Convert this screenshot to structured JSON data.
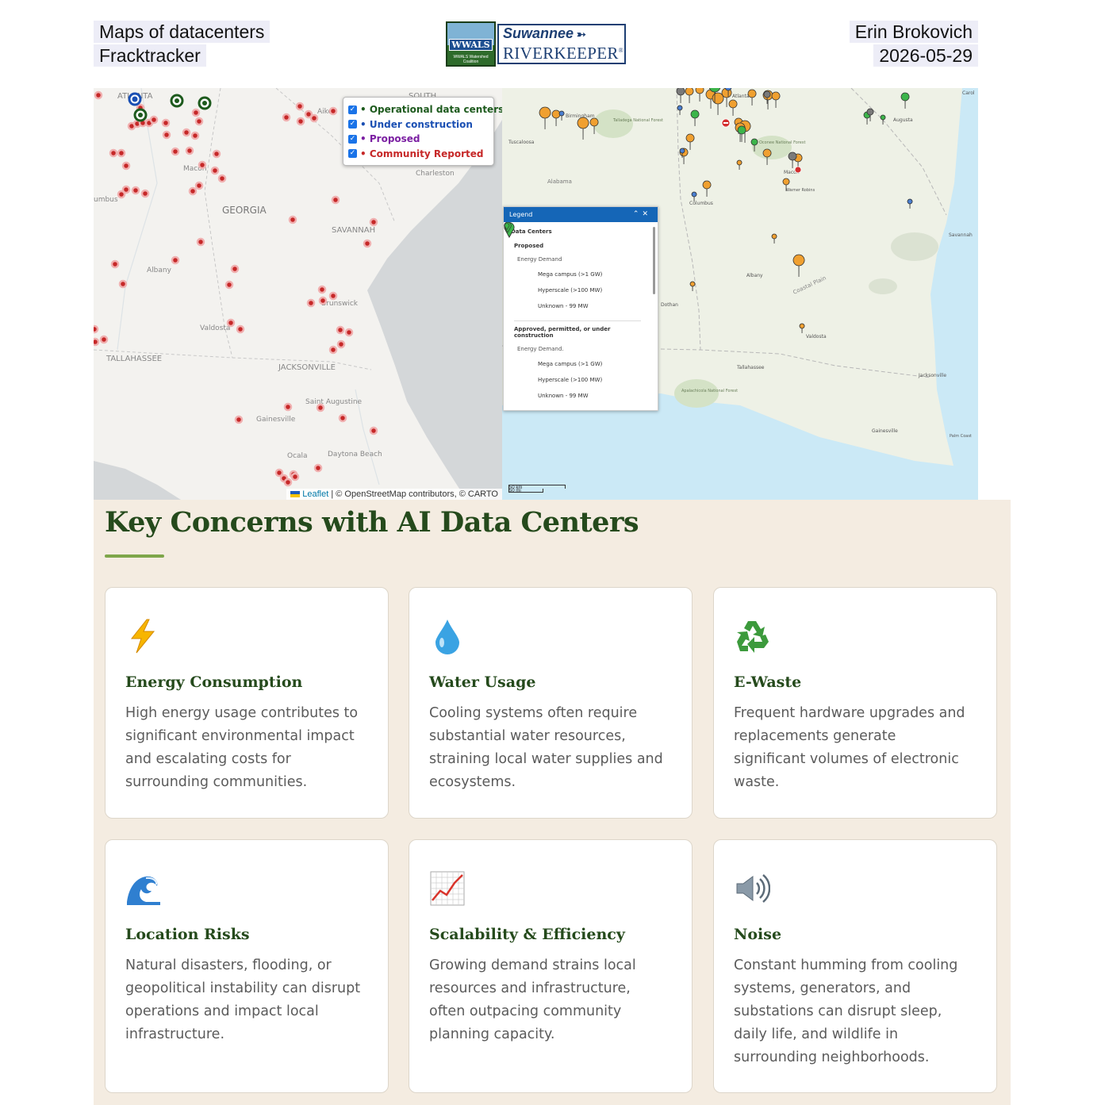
{
  "header": {
    "left_line1": "Maps of datacenters",
    "left_line2": "Fracktracker",
    "right_line1": "Erin Brokovich",
    "right_line2": "2026-05-29",
    "logo": {
      "badge_text": "WWALS",
      "badge_subtext": "WWALS Watershed Coalition",
      "name_line1": "Suwannee",
      "name_line2": "RIVERKEEPER",
      "name_line2_mark": "®"
    }
  },
  "left_map": {
    "place_labels": [
      "ATLANTA",
      "SOUTH",
      "Aiken",
      "Macon",
      "Charleston",
      "umbus",
      "GEORGIA",
      "SAVANNAH",
      "Albany",
      "Brunswick",
      "Valdosta",
      "TALLAHASSEE",
      "JACKSONVILLE",
      "Saint Augustine",
      "Gainesville",
      "Ocala",
      "Daytona Beach"
    ],
    "layers": [
      {
        "label": "Operational data centers",
        "color": "#1d5a1d",
        "checked": true
      },
      {
        "label": "Under construction",
        "color": "#1a4fb3",
        "checked": true
      },
      {
        "label": "Proposed",
        "color": "#7b1fa2",
        "checked": true
      },
      {
        "label": "Community Reported",
        "color": "#c62828",
        "checked": true
      }
    ],
    "attribution": {
      "leaflet": "Leaflet",
      "rest": " | © OpenStreetMap contributors, © CARTO"
    }
  },
  "right_map": {
    "place_labels": [
      "Birmingham",
      "Talladega National Forest",
      "Tuscaloosa",
      "Alabama",
      "Atlanta",
      "Augusta",
      "Oconee National Forest",
      "Macon",
      "Warner Robins",
      "Columbus",
      "Savannah",
      "Albany",
      "Coastal Plain",
      "Dothan",
      "Valdosta",
      "Tallahassee",
      "Apalachicola National Forest",
      "Jacksonville",
      "Gainesville",
      "Palm Coast",
      "Carol"
    ],
    "legend": {
      "header": "Legend",
      "title": "Data Centers",
      "group1": "Proposed",
      "group2": "Approved, permitted, or under construction",
      "energy_label": "Energy Demand",
      "group2_energy_label": "Energy Demand.",
      "items": [
        "Mega campus (>1 GW)",
        "Hyperscale (>100 MW)",
        "Unknown - 99 MW"
      ],
      "proposed_color": "#f0a030",
      "approved_color": "#3cb54a"
    },
    "scale": {
      "km": "50 km",
      "mi": "50 mi"
    }
  },
  "concerns": {
    "title": "Key Concerns with AI Data Centers",
    "cards": [
      {
        "icon": "lightning-icon",
        "title": "Energy Consumption",
        "text": "High energy usage contributes to significant environmental impact and escalating costs for surrounding communities."
      },
      {
        "icon": "water-drop-icon",
        "title": "Water Usage",
        "text": "Cooling systems often require substantial water resources, straining local water supplies and ecosystems."
      },
      {
        "icon": "recycle-icon",
        "title": "E-Waste",
        "text": "Frequent hardware upgrades and replacements generate significant volumes of electronic waste."
      },
      {
        "icon": "wave-icon",
        "title": "Location Risks",
        "text": "Natural disasters, flooding, or geopolitical instability can disrupt operations and impact local infrastructure."
      },
      {
        "icon": "chart-increasing-icon",
        "title": "Scalability & Efficiency",
        "text": "Growing demand strains local resources and infrastructure, often outpacing community planning capacity."
      },
      {
        "icon": "speaker-icon",
        "title": "Noise",
        "text": "Constant humming from cooling systems, generators, and substations can disrupt sleep, daily life, and wildlife in surrounding neighborhoods."
      }
    ]
  }
}
